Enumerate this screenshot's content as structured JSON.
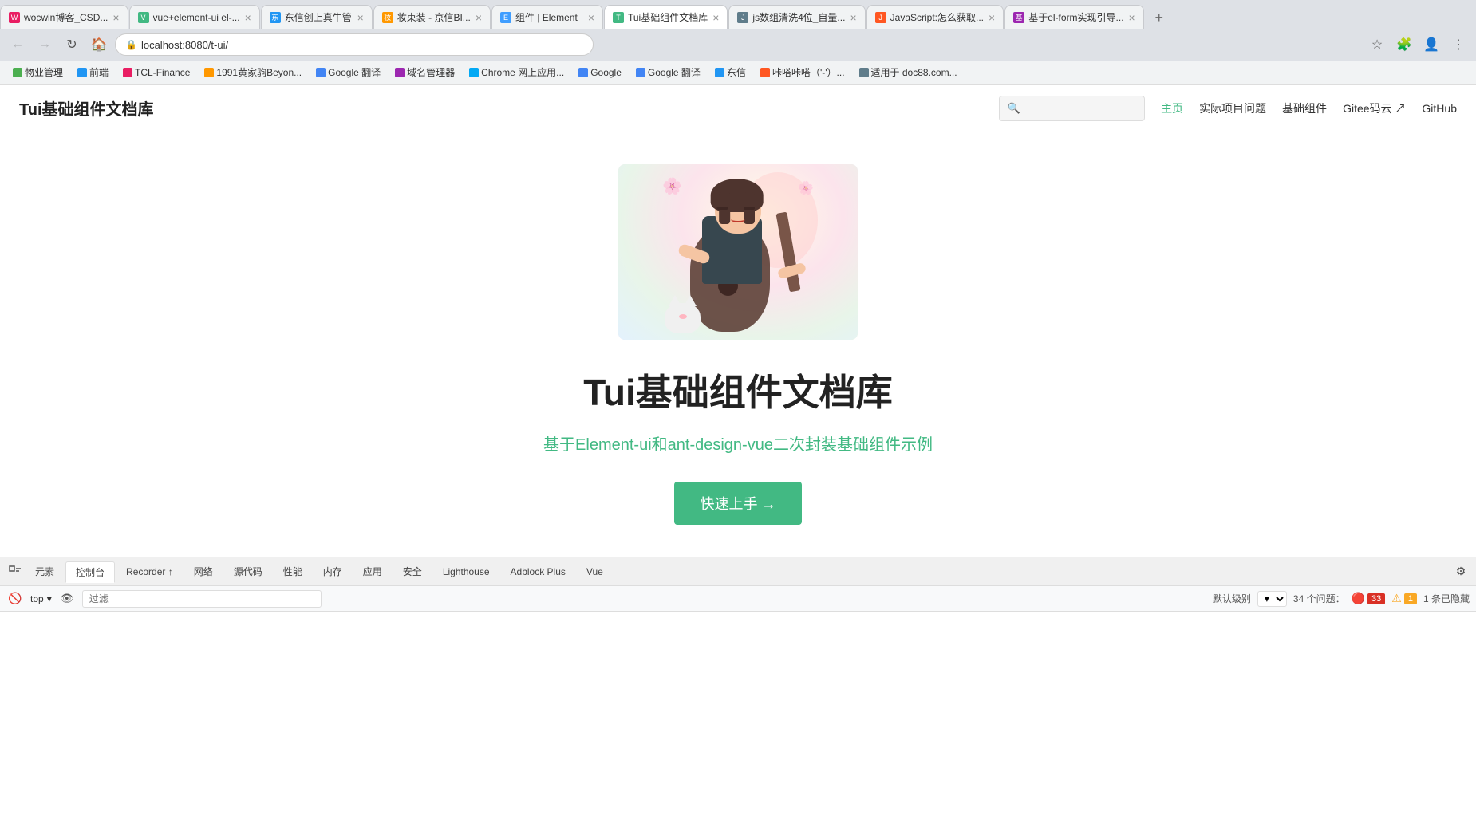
{
  "browser": {
    "tabs": [
      {
        "id": 1,
        "label": "wocwin博客_CSD...",
        "favicon": "W",
        "active": false
      },
      {
        "id": 2,
        "label": "vue+element-ui el-...",
        "favicon": "V",
        "active": false
      },
      {
        "id": 3,
        "label": "东信创上真牛管",
        "favicon": "东",
        "active": false
      },
      {
        "id": 4,
        "label": "妆束装 - 京信BI...",
        "favicon": "妆",
        "active": false
      },
      {
        "id": 5,
        "label": "组件 | Element",
        "favicon": "E",
        "active": false
      },
      {
        "id": 6,
        "label": "Tui基础组件文档库",
        "favicon": "T",
        "active": true
      },
      {
        "id": 7,
        "label": "js数组清洗4位_自量...",
        "favicon": "J",
        "active": false
      },
      {
        "id": 8,
        "label": "JavaScript:怎么获取...",
        "favicon": "J",
        "active": false
      },
      {
        "id": 9,
        "label": "基于el-form实现引导...",
        "favicon": "基",
        "active": false
      }
    ],
    "url": "localhost:8080/t-ui/",
    "bookmarks": [
      {
        "label": "物业管理",
        "favicon": "物"
      },
      {
        "label": "前端",
        "favicon": "前"
      },
      {
        "label": "TCL-Finance",
        "favicon": "T"
      },
      {
        "label": "1991黄家驹Beyon...",
        "favicon": "1"
      },
      {
        "label": "Google 翻译",
        "favicon": "G"
      },
      {
        "label": "域名管理器",
        "favicon": "域"
      },
      {
        "label": "Chrome 网上应用...",
        "favicon": "C"
      },
      {
        "label": "Google",
        "favicon": "G"
      },
      {
        "label": "Google 翻译",
        "favicon": "G"
      },
      {
        "label": "东信",
        "favicon": "东"
      },
      {
        "label": "咔嗒咔嗒（'-'）...",
        "favicon": "咔"
      },
      {
        "label": "适用于 doc88.com...",
        "favicon": "适"
      }
    ]
  },
  "site": {
    "logo": "Tui基础组件文档库",
    "search_placeholder": "",
    "nav_links": [
      {
        "label": "主页",
        "active": true
      },
      {
        "label": "实际项目问题",
        "active": false
      },
      {
        "label": "基础组件",
        "active": false
      },
      {
        "label": "Gitee码云 ↗",
        "active": false
      },
      {
        "label": "GitHub",
        "active": false
      }
    ]
  },
  "hero": {
    "title": "Tui基础组件文档库",
    "subtitle": "基于Element-ui和ant-design-vue二次封装基础组件示例",
    "button_label": "快速上手 →"
  },
  "devtools": {
    "tabs": [
      {
        "label": "元素",
        "active": false
      },
      {
        "label": "控制台",
        "active": true
      },
      {
        "label": "Recorder ↑",
        "active": false
      },
      {
        "label": "网络",
        "active": false
      },
      {
        "label": "源代码",
        "active": false
      },
      {
        "label": "性能",
        "active": false
      },
      {
        "label": "内存",
        "active": false
      },
      {
        "label": "应用",
        "active": false
      },
      {
        "label": "安全",
        "active": false
      },
      {
        "label": "Lighthouse",
        "active": false
      },
      {
        "label": "Adblock Plus",
        "active": false
      },
      {
        "label": "Vue",
        "active": false
      }
    ],
    "toolbar": {
      "top_label": "top",
      "filter_placeholder": "过滤",
      "level_label": "默认级别",
      "issues_count": "34 个问题：",
      "error_count": "33",
      "warning_count": "1",
      "hidden_count": "1 条已隐藏"
    }
  }
}
